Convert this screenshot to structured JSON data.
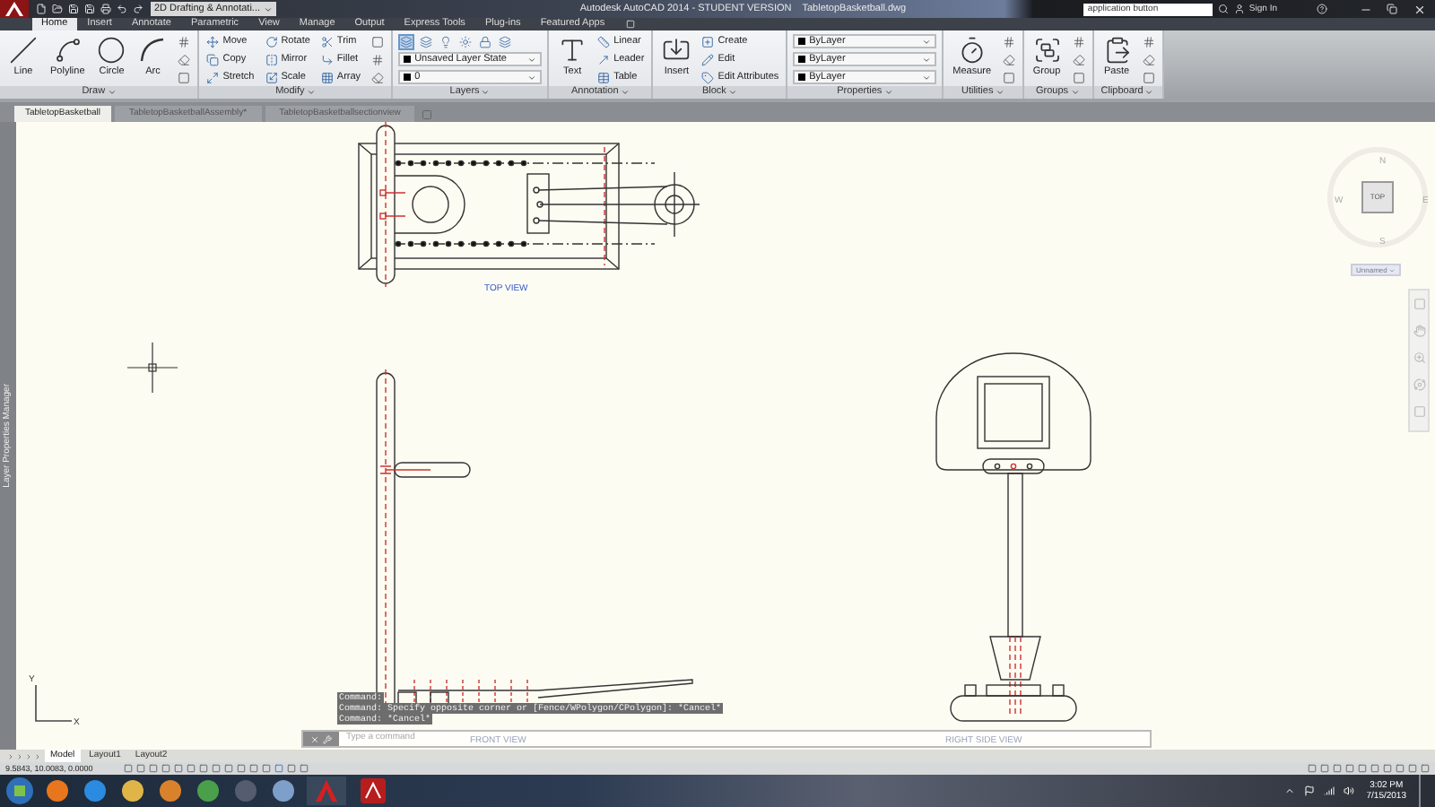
{
  "title_bar": {
    "workspace": "2D Drafting & Annotati...",
    "title": "Autodesk AutoCAD 2014 - STUDENT VERSION",
    "file_name": "TabletopBasketball.dwg",
    "search": {
      "value": "application button"
    },
    "sign_in": "Sign In"
  },
  "ribbon": {
    "tabs": [
      {
        "label": "Home",
        "selected": true
      },
      {
        "label": "Insert",
        "selected": false
      },
      {
        "label": "Annotate",
        "selected": false
      },
      {
        "label": "Parametric",
        "selected": false
      },
      {
        "label": "View",
        "selected": false
      },
      {
        "label": "Manage",
        "selected": false
      },
      {
        "label": "Output",
        "selected": false
      },
      {
        "label": "Express Tools",
        "selected": false
      },
      {
        "label": "Plug-ins",
        "selected": false
      },
      {
        "label": "Featured Apps",
        "selected": false
      }
    ],
    "panels": [
      {
        "title": "Draw",
        "tools": [
          {
            "kind": "large",
            "label": "Line"
          },
          {
            "kind": "large",
            "label": "Polyline"
          },
          {
            "kind": "large",
            "label": "Circle"
          },
          {
            "kind": "large",
            "label": "Arc"
          },
          {
            "kind": "icon"
          },
          {
            "kind": "icon"
          },
          {
            "kind": "icon"
          }
        ]
      },
      {
        "title": "Modify",
        "tools": [
          {
            "kind": "small",
            "label": "Move"
          },
          {
            "kind": "small",
            "label": "Copy"
          },
          {
            "kind": "small",
            "label": "Stretch"
          },
          {
            "kind": "small",
            "label": "Rotate"
          },
          {
            "kind": "small",
            "label": "Mirror"
          },
          {
            "kind": "small",
            "label": "Scale"
          },
          {
            "kind": "small",
            "label": "Trim"
          },
          {
            "kind": "small",
            "label": "Fillet"
          },
          {
            "kind": "small",
            "label": "Array"
          },
          {
            "kind": "icon"
          },
          {
            "kind": "icon"
          },
          {
            "kind": "icon"
          }
        ]
      },
      {
        "title": "Layers",
        "tools": [
          {
            "kind": "iconbar"
          },
          {
            "kind": "dropdown",
            "value": "Unsaved Layer State"
          },
          {
            "kind": "dropdown",
            "value": "0"
          }
        ]
      },
      {
        "title": "Annotation",
        "tools": [
          {
            "kind": "large",
            "label": "Text"
          },
          {
            "kind": "small",
            "label": "Linear"
          },
          {
            "kind": "small",
            "label": "Leader"
          },
          {
            "kind": "small",
            "label": "Table"
          }
        ]
      },
      {
        "title": "Block",
        "tools": [
          {
            "kind": "large",
            "label": "Insert"
          },
          {
            "kind": "small",
            "label": "Create"
          },
          {
            "kind": "small",
            "label": "Edit"
          },
          {
            "kind": "small",
            "label": "Edit Attributes"
          }
        ]
      },
      {
        "title": "Properties",
        "tools": [
          {
            "kind": "dropdown",
            "value": "ByLayer"
          },
          {
            "kind": "dropdown",
            "value": "ByLayer"
          },
          {
            "kind": "dropdown",
            "value": "ByLayer"
          }
        ]
      },
      {
        "title": "Utilities",
        "tools": [
          {
            "kind": "large",
            "label": "Measure"
          },
          {
            "kind": "icon"
          },
          {
            "kind": "icon"
          },
          {
            "kind": "icon"
          }
        ]
      },
      {
        "title": "Groups",
        "tools": [
          {
            "kind": "large",
            "label": "Group"
          },
          {
            "kind": "icon"
          },
          {
            "kind": "icon"
          },
          {
            "kind": "icon"
          }
        ]
      },
      {
        "title": "Clipboard",
        "tools": [
          {
            "kind": "large",
            "label": "Paste"
          },
          {
            "kind": "icon"
          },
          {
            "kind": "icon"
          },
          {
            "kind": "icon"
          }
        ]
      }
    ]
  },
  "file_tabs": [
    {
      "label": "TabletopBasketball",
      "selected": true
    },
    {
      "label": "TabletopBasketballAssembly*",
      "selected": false
    },
    {
      "label": "TabletopBasketballsectionview",
      "selected": false
    }
  ],
  "side_palette": {
    "title": "Layer Properties Manager"
  },
  "drawing": {
    "labels": [
      {
        "text": "TOP VIEW",
        "kind": "title"
      },
      {
        "text": "FRONT VIEW",
        "kind": "faded"
      },
      {
        "text": "RIGHT SIDE VIEW",
        "kind": "faded"
      }
    ],
    "ucs": {
      "x_label": "X",
      "y_label": "Y"
    }
  },
  "view_cube": {
    "face": "TOP",
    "directions": [
      "N",
      "W",
      "E",
      "S"
    ],
    "ucs_name": "Unnamed"
  },
  "command_line": {
    "history": [
      "Command:",
      "Command: Specify opposite corner or [Fence/WPolygon/CPolygon]: *Cancel*",
      "Command: *Cancel*"
    ],
    "placeholder": "Type a command"
  },
  "layout_tabs": [
    {
      "label": "Model",
      "selected": true
    },
    {
      "label": "Layout1",
      "selected": false
    },
    {
      "label": "Layout2",
      "selected": false
    }
  ],
  "status_bar": {
    "coordinates": "9.5843, 10.0083, 0.0000"
  },
  "taskbar": {
    "time": "3:02 PM",
    "date": "7/15/2013"
  }
}
